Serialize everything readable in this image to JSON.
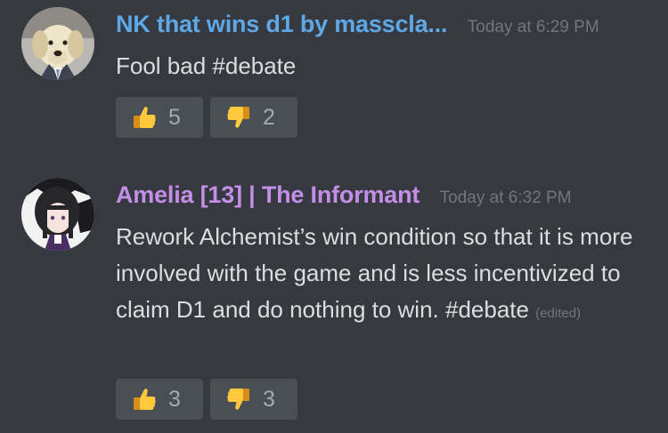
{
  "colors": {
    "background": "#36393f",
    "username_1": "#5ea8e6",
    "username_2": "#c28ee6",
    "text": "#dcddde",
    "muted": "#72767d",
    "reaction_bg": "#4a4e55"
  },
  "messages": [
    {
      "username": "NK that wins d1 by masscla...",
      "timestamp": "Today at 6:29 PM",
      "text": "Fool bad #debate",
      "edited": "",
      "avatar_icon": "dog-in-suit-avatar",
      "reactions": [
        {
          "emoji": "thumbs-up-icon",
          "count": "5"
        },
        {
          "emoji": "thumbs-down-icon",
          "count": "2"
        }
      ]
    },
    {
      "username": "Amelia [13] | The Informant",
      "timestamp": "Today at 6:32 PM",
      "text": "Rework Alchemist’s win condition so that it is more involved with the game and is less incentivized to claim D1 and do nothing to win. #debate",
      "edited": "(edited)",
      "avatar_icon": "anime-girl-avatar",
      "reactions": [
        {
          "emoji": "thumbs-up-icon",
          "count": "3"
        },
        {
          "emoji": "thumbs-down-icon",
          "count": "3"
        }
      ]
    }
  ]
}
